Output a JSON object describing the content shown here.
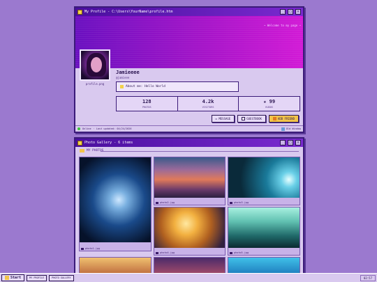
{
  "profile_window": {
    "title": "My Profile - C:\\Users\\YourName\\profile.htm",
    "welcome": "~ Welcome to my page ~",
    "avatar_caption": "profile.png",
    "username": "Jamieeee",
    "handle": "@jamieee",
    "about": "About me: Hello World",
    "stats": [
      {
        "value": "128",
        "label": "PHOTOS"
      },
      {
        "value": "4.2k",
        "label": "VISITORS"
      },
      {
        "value": "★ 99",
        "label": "KUDOS"
      }
    ],
    "actions": {
      "message": "✉ MESSAGE",
      "guestbook": "GUESTBOOK",
      "add_friend": "ADD FRIEND"
    },
    "status": {
      "online": "Online",
      "updated": "· Last updated: 04/24/2026",
      "right": "Old Window"
    }
  },
  "gallery_window": {
    "title": "Photo Gallery - 6 items",
    "section": "MY PHOTOS",
    "photos": [
      "photo1.jpg",
      "photo2.jpg",
      "photo3.jpg",
      "photo4.jpg",
      "photo5.jpg"
    ]
  },
  "taskbar": {
    "start": "Start",
    "tasks": [
      "MY PROFILE",
      "PHOTO GALLERY"
    ],
    "clock": "02:57"
  },
  "colors": {
    "desktop": "#9b79cf",
    "titlebar": "#4a0f9e",
    "accent": "#f2c44a",
    "online": "#3ac43a"
  }
}
